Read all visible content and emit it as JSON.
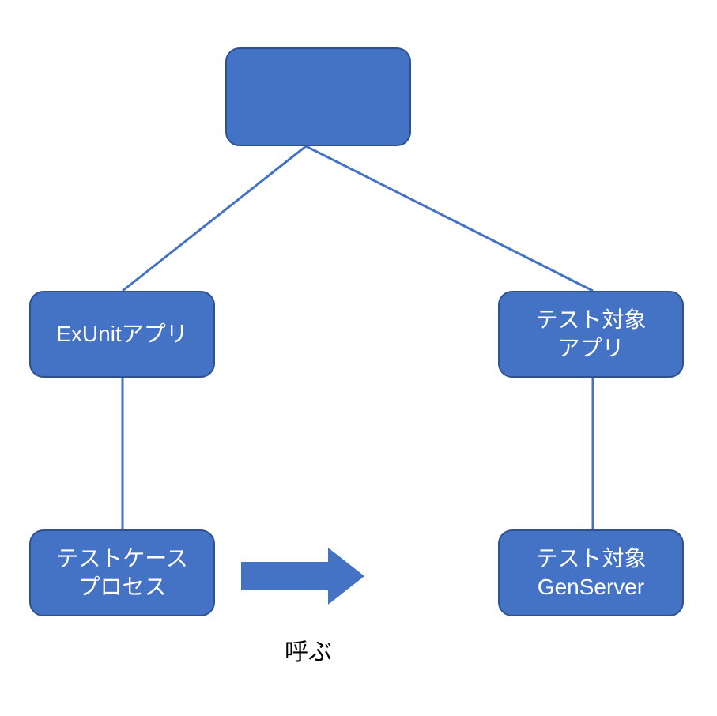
{
  "nodes": {
    "root": {
      "line1": "",
      "line2": ""
    },
    "exunit": {
      "line1": "ExUnitアプリ",
      "line2": ""
    },
    "targetApp": {
      "line1": "テスト対象",
      "line2": "アプリ"
    },
    "testCase": {
      "line1": "テストケース",
      "line2": "プロセス"
    },
    "targetGen": {
      "line1": "テスト対象",
      "line2": "GenServer"
    }
  },
  "arrowLabel": "呼ぶ",
  "colors": {
    "fill": "#4472C4",
    "stroke": "#2F528F"
  }
}
